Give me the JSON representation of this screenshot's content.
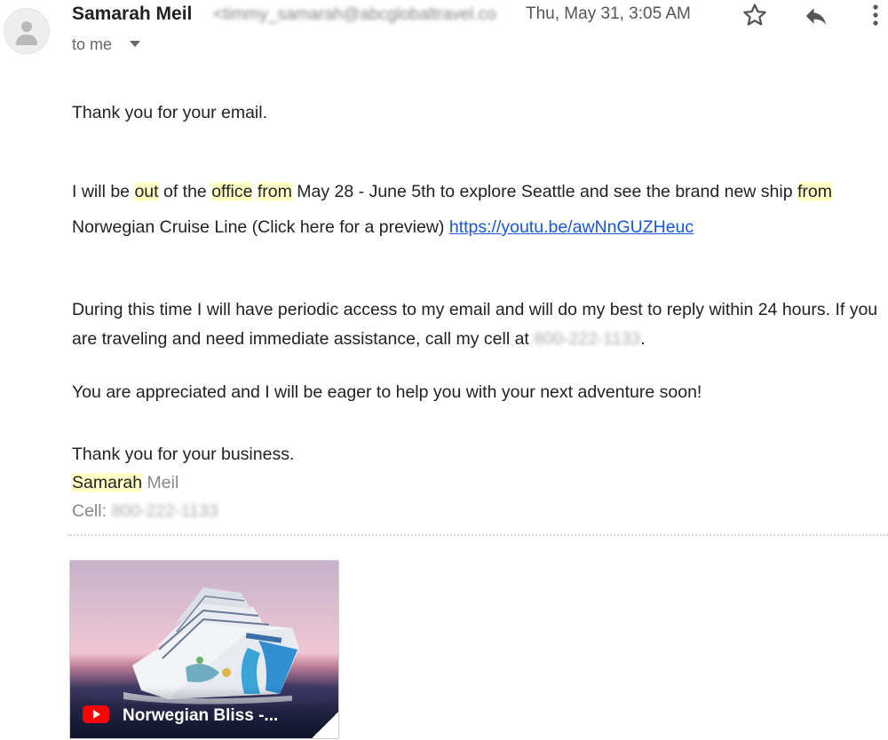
{
  "header": {
    "sender_name": "Samarah Meil",
    "sender_email": "<timmy_samarah@abcglobaltravel.com>",
    "date": "Thu, May 31, 3:05 AM",
    "to_label": "to me"
  },
  "icons": {
    "avatar": "person-icon",
    "star": "star-icon",
    "reply": "reply-icon",
    "more": "more-vert-icon",
    "caret": "caret-down-icon",
    "video": "youtube-icon"
  },
  "body": {
    "p1": "Thank you for your email.",
    "p2": {
      "t1": "I will be ",
      "h1": "out",
      "t2": " of the ",
      "h2": "office",
      "t3": " ",
      "h3": "from",
      "t4": " May 28 - June 5th to explore Seattle and see the brand new ship ",
      "h4": "from",
      "t5": " Norwegian Cruise Line (Click here for a preview) ",
      "link": "https://youtu.be/awNnGUZHeuc"
    },
    "p3": {
      "text": "During this time I will have periodic access to my email and will do my best to reply within 24 hours. If you are traveling and need immediate assistance, call my cell at ",
      "phone": "800-222-1133",
      "end": "."
    },
    "p4": "You are appreciated and I will be eager to help you with your next adventure soon!",
    "signature": {
      "thanks": "Thank you for your business.",
      "first_name": "Samarah",
      "last_name": " Meil",
      "cell_label": "Cell: ",
      "cell_value": "800-222-1133"
    }
  },
  "attachment": {
    "title": "Norwegian Bliss -..."
  },
  "colors": {
    "highlight": "#ffffc8",
    "link": "#1a56d9",
    "youtube_red": "#ff0000"
  }
}
